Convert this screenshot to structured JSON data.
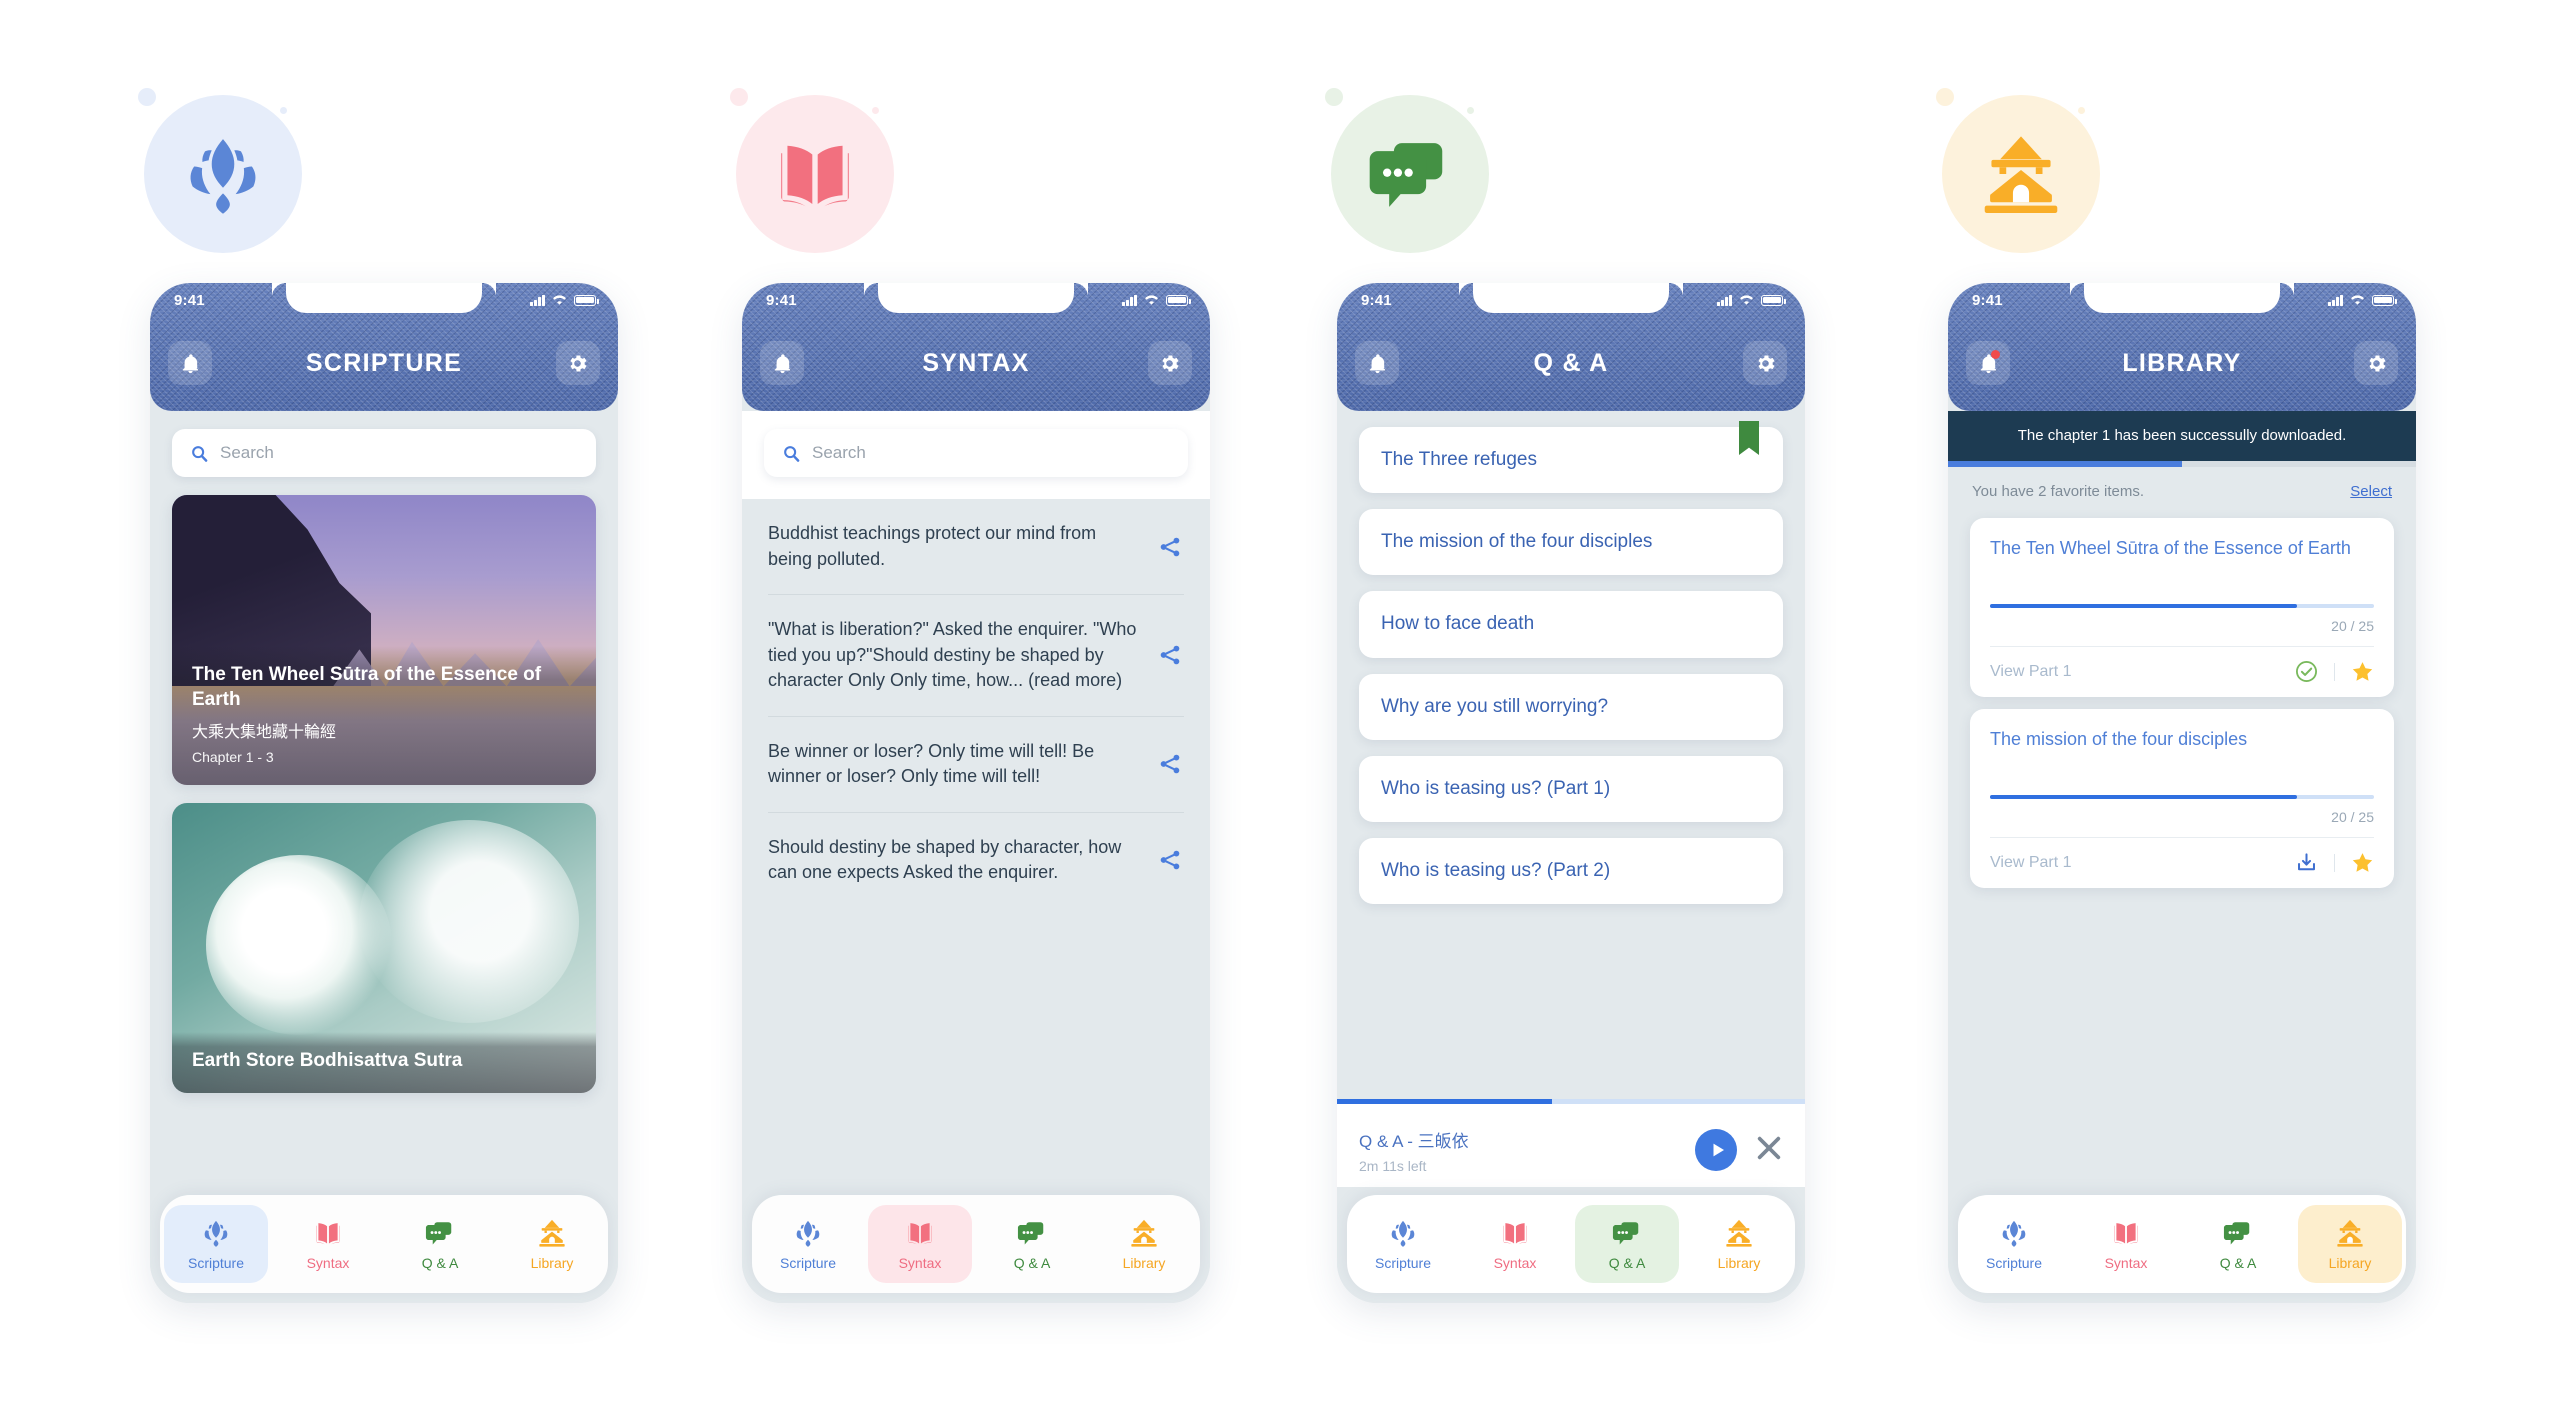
{
  "palette": {
    "denim": "#5873b4",
    "scripture_blue": "#4f7fd6",
    "syntax_pink": "#ef6d82",
    "qa_green": "#3f8a3f",
    "library_orange": "#f5a623",
    "toast_navy": "#1d3b52",
    "progress_blue": "#2f6fe0",
    "star_gold": "#fcc02e",
    "page_bg": "#ffffff",
    "screen_bg": "#e3e9ec"
  },
  "status_bar": {
    "time": "9:41",
    "signal": "signal-bars-icon",
    "wifi": "wifi-icon",
    "battery": "battery-icon"
  },
  "tabs": [
    {
      "label": "Scripture",
      "icon": "lotus-icon",
      "key": "scripture"
    },
    {
      "label": "Syntax",
      "icon": "open-book-icon",
      "key": "syntax"
    },
    {
      "label": "Q & A",
      "icon": "chat-bubbles-icon",
      "key": "qa"
    },
    {
      "label": "Library",
      "icon": "pagoda-icon",
      "key": "library"
    }
  ],
  "screens": [
    {
      "key": "scripture",
      "badge_icon": "lotus-icon",
      "header": {
        "title": "SCRIPTURE",
        "left_icon": "bell-icon",
        "right_icon": "gear-icon",
        "badge": false
      },
      "search": {
        "placeholder": "Search",
        "icon": "search-icon"
      },
      "cards": [
        {
          "title": "The Ten Wheel Sūtra of the Essence of Earth",
          "title_cn": "大乘大集地藏十輪經",
          "chapter": "Chapter 1 - 3",
          "image": "mountain-lake-photo"
        },
        {
          "title": "Earth Store Bodhisattva Sutra",
          "title_cn": "",
          "chapter": "",
          "image": "white-blossom-photo"
        }
      ],
      "active_tab": "scripture"
    },
    {
      "key": "syntax",
      "badge_icon": "open-book-icon",
      "header": {
        "title": "SYNTAX",
        "left_icon": "bell-icon",
        "right_icon": "gear-icon",
        "badge": false
      },
      "search": {
        "placeholder": "Search",
        "icon": "search-icon"
      },
      "quotes": [
        {
          "text": "Buddhist teachings protect our mind from being polluted.",
          "share_icon": "share-icon"
        },
        {
          "text": "\"What is liberation?\" Asked the enquirer.  \"Who tied you up?\"Should destiny be shaped by character Only Only time, how... (read more)",
          "share_icon": "share-icon"
        },
        {
          "text": "Be winner or loser? Only time will tell! Be winner or loser? Only time will tell!",
          "share_icon": "share-icon"
        },
        {
          "text": "Should destiny be shaped by character, how can one expects Asked the enquirer.",
          "share_icon": "share-icon"
        }
      ],
      "active_tab": "syntax"
    },
    {
      "key": "qa",
      "badge_icon": "chat-bubbles-icon",
      "header": {
        "title": "Q & A",
        "left_icon": "bell-icon",
        "right_icon": "gear-icon",
        "badge": false
      },
      "questions": [
        {
          "title": "The Three refuges",
          "bookmarked": true
        },
        {
          "title": "The mission of the four disciples",
          "bookmarked": false
        },
        {
          "title": "How to face death",
          "bookmarked": false
        },
        {
          "title": "Why are you still worrying?",
          "bookmarked": false
        },
        {
          "title": "Who is teasing us? (Part 1)",
          "bookmarked": false
        },
        {
          "title": "Who is teasing us? (Part 2)",
          "bookmarked": false
        }
      ],
      "player": {
        "title": "Q & A - 三皈依",
        "time_left": "2m 11s left",
        "progress_percent": 46,
        "play_icon": "play-icon",
        "close_icon": "close-icon"
      },
      "active_tab": "qa"
    },
    {
      "key": "library",
      "badge_icon": "pagoda-icon",
      "header": {
        "title": "LIBRARY",
        "left_icon": "bell-icon",
        "right_icon": "gear-icon",
        "badge": true
      },
      "toast": "The chapter 1 has been successully downloaded.",
      "download_progress_percent": 50,
      "favorites_note": "You have 2 favorite items.",
      "select_label": "Select",
      "items": [
        {
          "title": "The Ten Wheel Sūtra of the Essence of Earth",
          "progress_percent": 80,
          "count": "20 / 25",
          "action_label": "View Part 1",
          "status_icon": "check-circle-icon",
          "fav_icon": "star-icon"
        },
        {
          "title": "The mission of the four disciples",
          "progress_percent": 80,
          "count": "20 / 25",
          "action_label": "View Part 1",
          "status_icon": "download-icon",
          "fav_icon": "star-icon"
        }
      ],
      "active_tab": "library"
    }
  ]
}
